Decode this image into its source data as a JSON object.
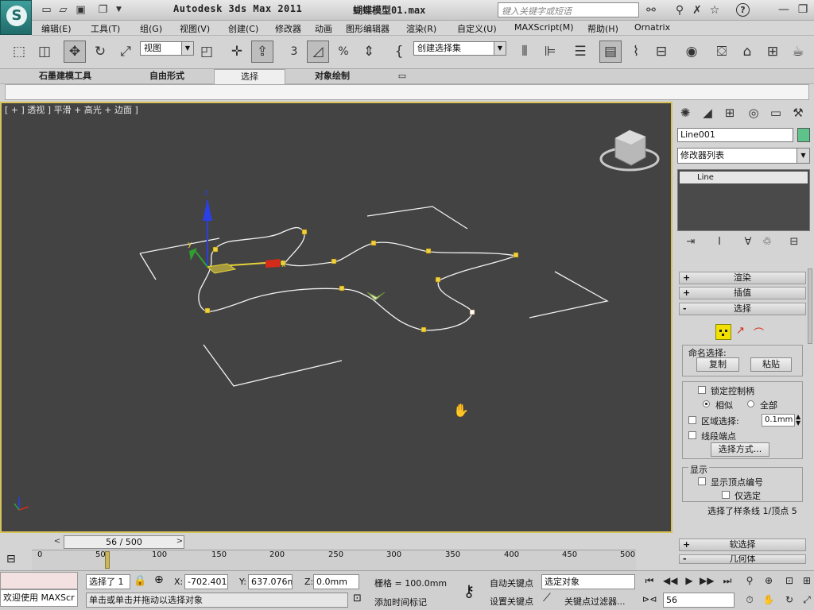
{
  "window": {
    "app_title": "Autodesk 3ds Max  2011",
    "file_title": "蝴蝶模型01.max",
    "search_placeholder": "键入关键字或短语",
    "help_label": "?"
  },
  "menu": [
    "编辑(E)",
    "工具(T)",
    "组(G)",
    "视图(V)",
    "创建(C)",
    "修改器",
    "动画",
    "图形编辑器",
    "渲染(R)",
    "自定义(U)",
    "MAXScript(M)",
    "帮助(H)",
    "Ornatrix"
  ],
  "toolbar": {
    "view_combo": "视图",
    "selection_set_combo": "创建选择集",
    "snap_label": "3",
    "angle_snap_label": "%"
  },
  "ribbon": {
    "tabs": [
      "石墨建模工具",
      "自由形式",
      "选择",
      "对象绘制"
    ],
    "selected_tab": "选择"
  },
  "viewport": {
    "label": "[ + ] 透视 ] 平滑 + 高光 + 边面 ]",
    "axis_x": "x",
    "axis_y": "y",
    "axis_z": "z"
  },
  "command_panel": {
    "object_name": "Line001",
    "object_color": "#5ec38a",
    "modifier_list": "修改器列表",
    "stack_item": "Line",
    "rollouts": {
      "render": "渲染",
      "interpolation": "插值",
      "selection": "选择",
      "soft_selection": "软选择",
      "geometry": "几何体"
    },
    "named_selection": {
      "title": "命名选择:",
      "copy": "复制",
      "paste": "粘贴"
    },
    "lock_handles": "锁定控制柄",
    "alike": "相似",
    "all": "全部",
    "area_selection": "区域选择:",
    "area_value": "0.1mm",
    "segment_end": "线段端点",
    "select_by": "选择方式...",
    "display": {
      "title": "显示",
      "show_vertex_numbers": "显示顶点编号",
      "selected_only": "仅选定"
    },
    "status": "选择了样条线 1/顶点 5"
  },
  "timeline": {
    "current": "56 / 500",
    "ticks": [
      "0",
      "50",
      "100",
      "150",
      "200",
      "250",
      "300",
      "350",
      "400",
      "450",
      "500"
    ]
  },
  "statusbar": {
    "maxscript_label": "欢迎使用 MAXScr",
    "selected": "选择了 1",
    "x_label": "X:",
    "x_value": "-702.401m",
    "y_label": "Y:",
    "y_value": "637.076mr",
    "z_label": "Z:",
    "z_value": "0.0mm",
    "grid": "栅格 = 100.0mm",
    "prompt": "单击或单击并拖动以选择对象",
    "add_time_tag": "添加时间标记",
    "auto_key": "自动关键点",
    "set_key": "设置关键点",
    "key_mode": "选定对象",
    "key_filters": "关键点过滤器...",
    "frame": "56"
  }
}
